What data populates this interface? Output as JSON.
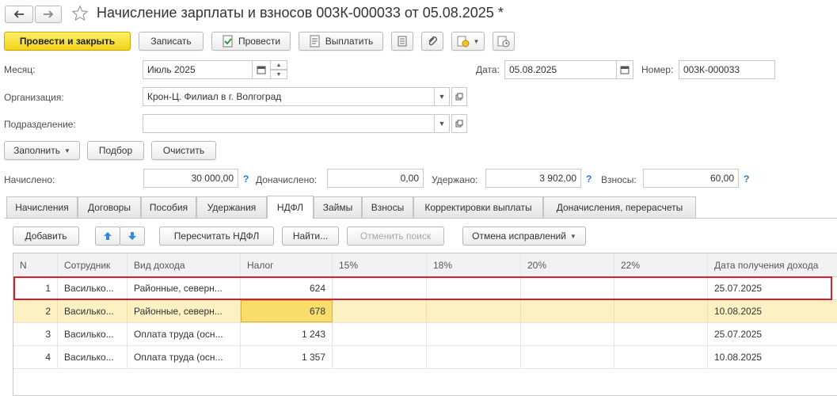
{
  "window": {
    "title": "Начисление зарплаты и взносов 003К-000033 от 05.08.2025 *",
    "back_icon": "arrow-left-icon",
    "forward_icon": "arrow-right-icon",
    "favorite_icon": "star-icon"
  },
  "toolbar": {
    "post_close": "Провести и закрыть",
    "save": "Записать",
    "post": "Провести",
    "pay": "Выплатить"
  },
  "header": {
    "month_label": "Месяц:",
    "month_value": "Июль 2025",
    "date_label": "Дата:",
    "date_value": "05.08.2025",
    "number_label": "Номер:",
    "number_value": "003К-000033",
    "org_label": "Организация:",
    "org_value": "Крон-Ц. Филиал в г. Волгоград",
    "dept_label": "Подразделение:",
    "dept_value": ""
  },
  "actions": {
    "fill": "Заполнить",
    "select": "Подбор",
    "clear": "Очистить"
  },
  "totals": {
    "accrued_label": "Начислено:",
    "accrued_value": "30 000,00",
    "extra_label": "Доначислено:",
    "extra_value": "0,00",
    "withheld_label": "Удержано:",
    "withheld_value": "3 902,00",
    "contrib_label": "Взносы:",
    "contrib_value": "60,00",
    "help_mark": "?"
  },
  "tabs": [
    "Начисления",
    "Договоры",
    "Пособия",
    "Удержания",
    "НДФЛ",
    "Займы",
    "Взносы",
    "Корректировки выплаты",
    "Доначисления, перерасчеты"
  ],
  "active_tab": "НДФЛ",
  "table_toolbar": {
    "add": "Добавить",
    "recalc": "Пересчитать НДФЛ",
    "find": "Найти...",
    "cancel_search": "Отменить поиск",
    "cancel_fix": "Отмена исправлений"
  },
  "table": {
    "columns": [
      "N",
      "Сотрудник",
      "Вид дохода",
      "Налог",
      "15%",
      "18%",
      "20%",
      "22%",
      "Дата получения дохода"
    ],
    "rows": [
      {
        "n": "1",
        "employee": "Василько...",
        "income": "Районные, северн...",
        "tax": "624",
        "p15": "",
        "p18": "",
        "p20": "",
        "p22": "",
        "date": "25.07.2025"
      },
      {
        "n": "2",
        "employee": "Василько...",
        "income": "Районные, северн...",
        "tax": "678",
        "p15": "",
        "p18": "",
        "p20": "",
        "p22": "",
        "date": "10.08.2025"
      },
      {
        "n": "3",
        "employee": "Василько...",
        "income": "Оплата труда (осн...",
        "tax": "1 243",
        "p15": "",
        "p18": "",
        "p20": "",
        "p22": "",
        "date": "25.07.2025"
      },
      {
        "n": "4",
        "employee": "Василько...",
        "income": "Оплата труда (осн...",
        "tax": "1 357",
        "p15": "",
        "p18": "",
        "p20": "",
        "p22": "",
        "date": "10.08.2025"
      }
    ]
  },
  "colors": {
    "primary_button": "#f5d92a",
    "selected_row": "#fbf1c2",
    "current_cell": "#f8dd6c",
    "highlight_frame": "#d81e2c",
    "help_mark": "#2a79c9"
  }
}
